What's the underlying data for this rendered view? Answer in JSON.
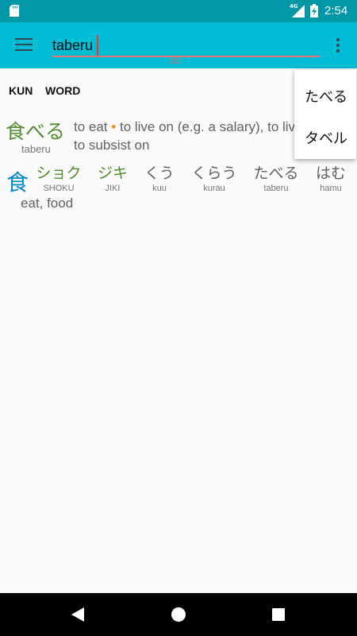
{
  "status_bar": {
    "network": "4G",
    "time": "2:54"
  },
  "search": {
    "value": "taberu",
    "counter": "2/2"
  },
  "tabs": [
    "KUN",
    "WORD"
  ],
  "word_entry": {
    "kanji": "食べる",
    "romaji": "taberu",
    "meanings": [
      "to eat",
      "to live on (e.g. a salary), to live off, to subsist on"
    ]
  },
  "kanji_entry": {
    "character": "食",
    "on_readings": [
      {
        "kana": "ショク",
        "romaji": "SHOKU"
      },
      {
        "kana": "ジキ",
        "romaji": "JIKI"
      }
    ],
    "kun_readings": [
      {
        "kana": "くう",
        "romaji": "kuu"
      },
      {
        "kana": "くらう",
        "romaji": "kurau"
      },
      {
        "kana": "たべる",
        "romaji": "taberu"
      },
      {
        "kana": "はむ",
        "romaji": "hamu"
      }
    ],
    "meaning": "eat, food"
  },
  "suggestions": [
    "たべる",
    "タベル"
  ],
  "colors": {
    "status_bar": "#0097a7",
    "app_bar": "#00bcd4",
    "kanji_blue": "#0288d1",
    "reading_green": "#558b2f",
    "accent_orange": "#ef8f00"
  },
  "icons": {
    "status_left": "sd-card-icon",
    "network": "signal-icon",
    "battery": "battery-charging-icon",
    "menu": "hamburger-menu-icon",
    "overflow": "more-vert-icon",
    "back": "back-icon",
    "home": "home-icon",
    "recents": "recents-icon"
  }
}
